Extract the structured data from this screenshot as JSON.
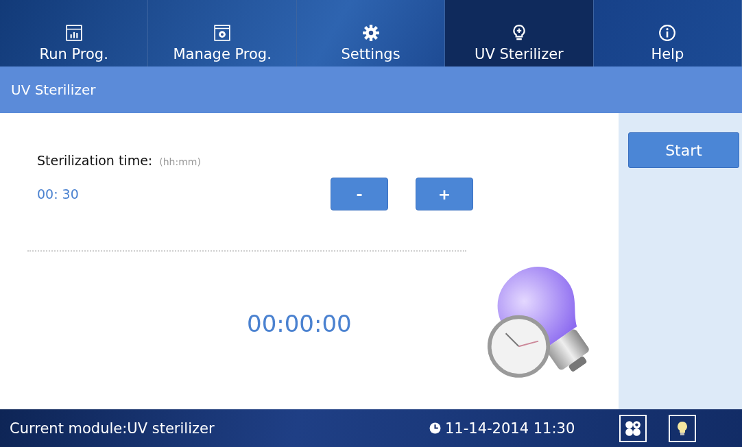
{
  "tabs": [
    {
      "label": "Run Prog.",
      "selected": false
    },
    {
      "label": "Manage Prog.",
      "selected": false
    },
    {
      "label": "Settings",
      "selected": false
    },
    {
      "label": "UV Sterilizer",
      "selected": true
    },
    {
      "label": "Help",
      "selected": false
    }
  ],
  "page_title": "UV Sterilizer",
  "time_label": "Sterilization time:",
  "time_hint": "(hh:mm)",
  "time_value": "00: 30",
  "buttons": {
    "minus": "-",
    "plus": "+",
    "start": "Start"
  },
  "countdown": "00:00:00",
  "status_bar": {
    "module": "Current module:UV sterilizer",
    "datetime": "11-14-2014 11:30"
  }
}
